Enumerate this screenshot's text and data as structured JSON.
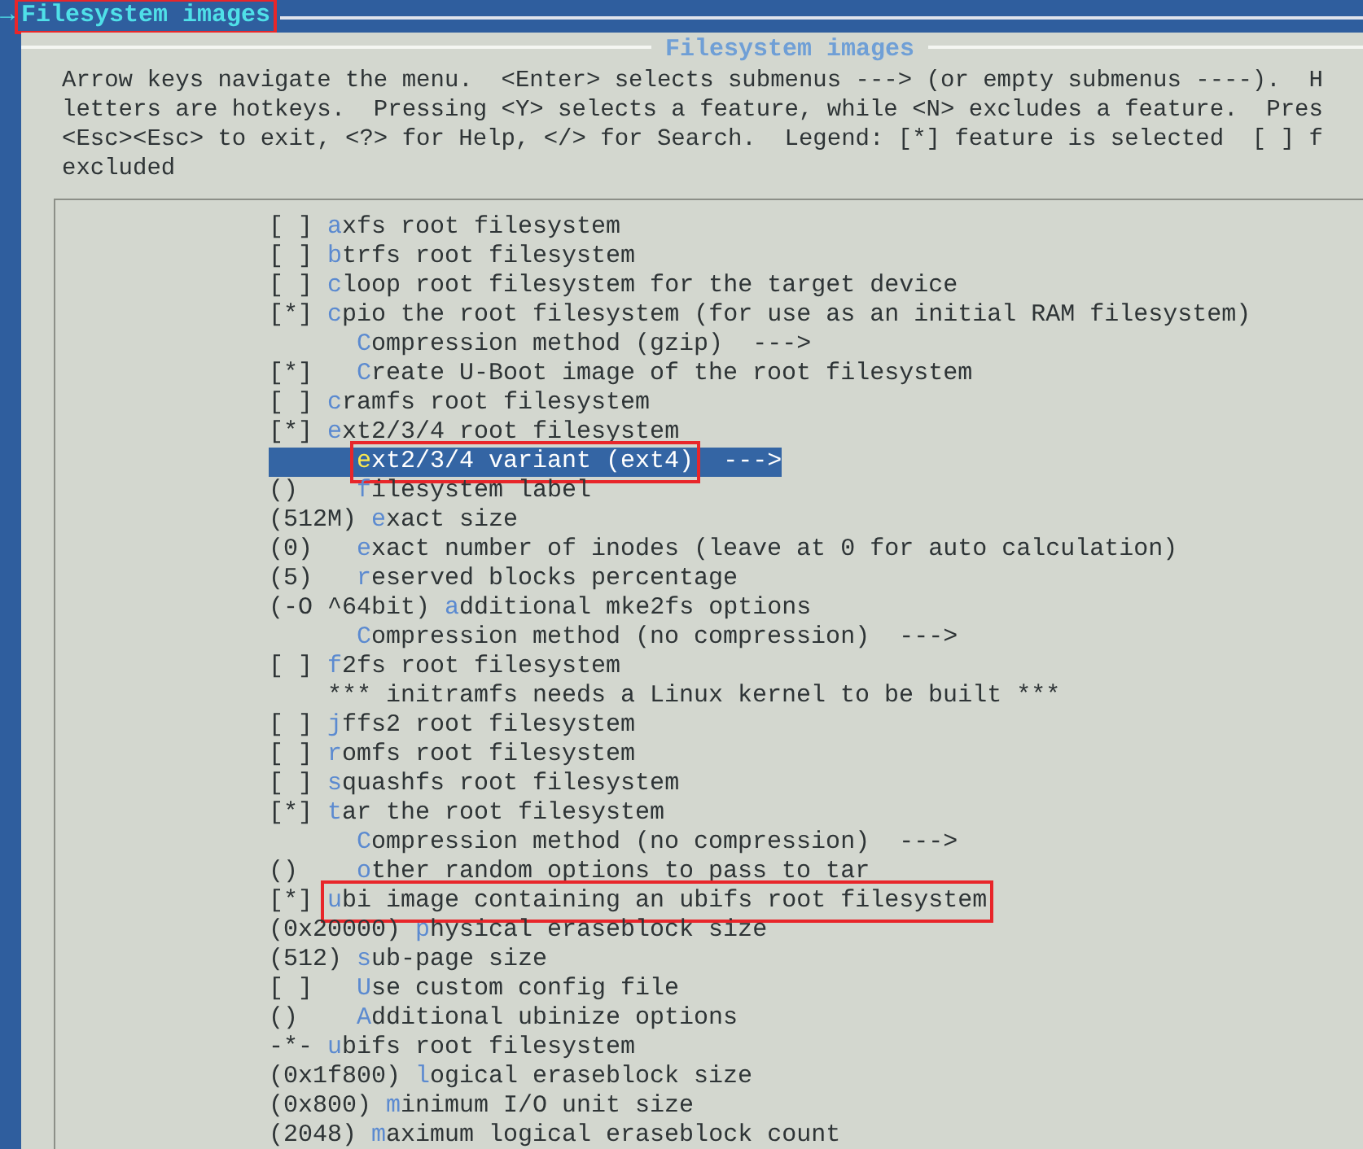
{
  "top_bar": {
    "arrow": "→",
    "title": "Filesystem images",
    "annotated": true
  },
  "dialog": {
    "title": "Filesystem images",
    "help_lines": [
      "Arrow keys navigate the menu.  <Enter> selects submenus ---> (or empty submenus ----).  H",
      "letters are hotkeys.  Pressing <Y> selects a feature, while <N> excludes a feature.  Pres",
      "<Esc><Esc> to exit, <?> for Help, </> for Search.  Legend: [*] feature is selected  [ ] f",
      "excluded"
    ]
  },
  "menu": [
    {
      "prefix": "[ ]",
      "hotkey": "a",
      "rest": "xfs root filesystem",
      "selected": false
    },
    {
      "prefix": "[ ]",
      "hotkey": "b",
      "rest": "trfs root filesystem",
      "selected": false
    },
    {
      "prefix": "[ ]",
      "hotkey": "c",
      "rest": "loop root filesystem for the target device",
      "selected": false
    },
    {
      "prefix": "[*]",
      "hotkey": "c",
      "rest": "pio the root filesystem (for use as an initial RAM filesystem)",
      "selected": false,
      "children": [
        {
          "hotkey": "C",
          "rest": "ompression method (gzip)",
          "arrow": "--->",
          "selected": false
        },
        {
          "prefix": "[*]",
          "hotkey": "C",
          "rest": "reate U-Boot image of the root filesystem",
          "selected": false
        }
      ]
    },
    {
      "prefix": "[ ]",
      "hotkey": "c",
      "rest": "ramfs root filesystem",
      "selected": false
    },
    {
      "prefix": "[*]",
      "hotkey": "e",
      "rest": "xt2/3/4 root filesystem",
      "selected": false,
      "children": [
        {
          "hotkey": "e",
          "rest": "xt2/3/4 variant (ext4)",
          "arrow": "--->",
          "selected": true,
          "annotated": true
        },
        {
          "prefix": "()",
          "hotkey": "f",
          "rest": "ilesystem label",
          "selected": false
        },
        {
          "prefix": "(512M)",
          "hotkey": "e",
          "rest": "xact size",
          "selected": false
        },
        {
          "prefix": "(0)",
          "hotkey": "e",
          "rest": "xact number of inodes (leave at 0 for auto calculation)",
          "selected": false
        },
        {
          "prefix": "(5)",
          "hotkey": "r",
          "rest": "eserved blocks percentage",
          "selected": false
        },
        {
          "prefix": "(-O ^64bit)",
          "hotkey": "a",
          "rest": "dditional mke2fs options",
          "selected": false
        },
        {
          "hotkey": "C",
          "rest": "ompression method (no compression)",
          "arrow": "--->",
          "selected": false
        }
      ]
    },
    {
      "prefix": "[ ]",
      "hotkey": "f",
      "rest": "2fs root filesystem",
      "selected": false
    },
    {
      "rest": "*** initramfs needs a Linux kernel to be built ***",
      "selected": false
    },
    {
      "prefix": "[ ]",
      "hotkey": "j",
      "rest": "ffs2 root filesystem",
      "selected": false
    },
    {
      "prefix": "[ ]",
      "hotkey": "r",
      "rest": "omfs root filesystem",
      "selected": false
    },
    {
      "prefix": "[ ]",
      "hotkey": "s",
      "rest": "quashfs root filesystem",
      "selected": false
    },
    {
      "prefix": "[*]",
      "hotkey": "t",
      "rest": "ar the root filesystem",
      "selected": false,
      "children": [
        {
          "hotkey": "C",
          "rest": "ompression method (no compression)",
          "arrow": "--->",
          "selected": false
        },
        {
          "prefix": "()",
          "hotkey": "o",
          "rest": "ther random options to pass to tar",
          "selected": false
        }
      ]
    },
    {
      "prefix": "[*]",
      "hotkey": "u",
      "rest": "bi image containing an ubifs root filesystem",
      "selected": false,
      "annotated": true,
      "children": [
        {
          "prefix": "(0x20000)",
          "hotkey": "p",
          "rest": "hysical eraseblock size",
          "selected": false
        },
        {
          "prefix": "(512)",
          "hotkey": "s",
          "rest": "ub-page size",
          "selected": false
        },
        {
          "prefix": "[ ]",
          "hotkey": "U",
          "rest": "se custom config file",
          "selected": false
        },
        {
          "prefix": "()",
          "hotkey": "A",
          "rest": "dditional ubinize options",
          "selected": false
        }
      ]
    },
    {
      "prefix": "-*-",
      "hotkey": "u",
      "rest": "bifs root filesystem",
      "selected": false,
      "children": [
        {
          "prefix": "(0x1f800)",
          "hotkey": "l",
          "rest": "ogical eraseblock size",
          "selected": false
        },
        {
          "prefix": "(0x800)",
          "hotkey": "m",
          "rest": "inimum I/O unit size",
          "selected": false
        },
        {
          "prefix": "(2048)",
          "hotkey": "m",
          "rest": "aximum logical eraseblock count",
          "selected": false
        }
      ]
    }
  ]
}
